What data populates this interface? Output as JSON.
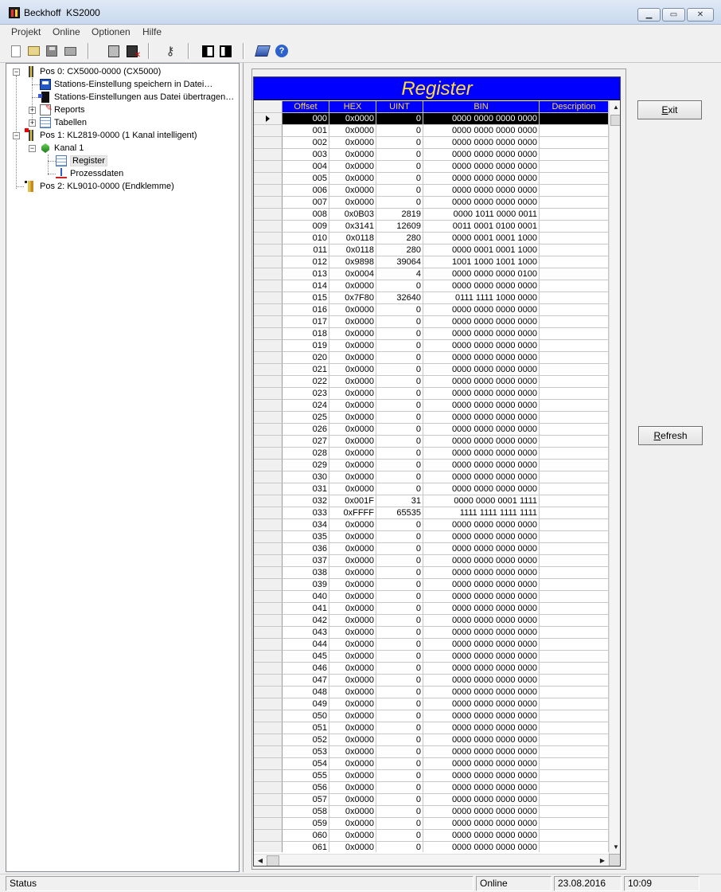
{
  "window": {
    "title": "Beckhoff  KS2000",
    "min": "▁",
    "max": "▭",
    "close": "✕"
  },
  "menu": [
    "Projekt",
    "Online",
    "Optionen",
    "Hilfe"
  ],
  "toolbar": [
    "new-icon",
    "open-icon",
    "save-icon",
    "print-icon",
    "online-icon",
    "offline-icon",
    "key-icon",
    "left-pane-icon",
    "right-pane-icon",
    "book-icon",
    "help-icon"
  ],
  "tree": [
    {
      "label": "Pos 0: CX5000-0000  (CX5000)",
      "icon": "cx5000-icon",
      "expander": "−"
    },
    {
      "label": "Stations-Einstellung speichern in Datei…",
      "icon": "save-settings-icon"
    },
    {
      "label": "Stations-Einstellungen aus Datei übertragen…",
      "icon": "load-settings-icon"
    },
    {
      "label": "Reports",
      "icon": "reports-icon",
      "expander": "+"
    },
    {
      "label": "Tabellen",
      "icon": "tables-icon",
      "expander": "+"
    },
    {
      "label": "Pos 1: KL2819-0000  (1 Kanal intelligent)",
      "icon": "kl2819-icon",
      "expander": "−"
    },
    {
      "label": "Kanal 1",
      "icon": "channel-icon",
      "expander": "−"
    },
    {
      "label": "Register",
      "icon": "register-icon"
    },
    {
      "label": "Prozessdaten",
      "icon": "process-data-icon"
    },
    {
      "label": "Pos 2: KL9010-0000  (Endklemme)",
      "icon": "kl9010-icon"
    }
  ],
  "grid": {
    "caption": "Register",
    "columns": [
      "Offset",
      "HEX",
      "UINT",
      "BIN",
      "Description"
    ],
    "rows": [
      [
        "000",
        "0x0000",
        "0",
        "0000 0000 0000 0000",
        ""
      ],
      [
        "001",
        "0x0000",
        "0",
        "0000 0000 0000 0000",
        ""
      ],
      [
        "002",
        "0x0000",
        "0",
        "0000 0000 0000 0000",
        ""
      ],
      [
        "003",
        "0x0000",
        "0",
        "0000 0000 0000 0000",
        ""
      ],
      [
        "004",
        "0x0000",
        "0",
        "0000 0000 0000 0000",
        ""
      ],
      [
        "005",
        "0x0000",
        "0",
        "0000 0000 0000 0000",
        ""
      ],
      [
        "006",
        "0x0000",
        "0",
        "0000 0000 0000 0000",
        ""
      ],
      [
        "007",
        "0x0000",
        "0",
        "0000 0000 0000 0000",
        ""
      ],
      [
        "008",
        "0x0B03",
        "2819",
        "0000 1011 0000 0011",
        ""
      ],
      [
        "009",
        "0x3141",
        "12609",
        "0011 0001 0100 0001",
        ""
      ],
      [
        "010",
        "0x0118",
        "280",
        "0000 0001 0001 1000",
        ""
      ],
      [
        "011",
        "0x0118",
        "280",
        "0000 0001 0001 1000",
        ""
      ],
      [
        "012",
        "0x9898",
        "39064",
        "1001 1000 1001 1000",
        ""
      ],
      [
        "013",
        "0x0004",
        "4",
        "0000 0000 0000 0100",
        ""
      ],
      [
        "014",
        "0x0000",
        "0",
        "0000 0000 0000 0000",
        ""
      ],
      [
        "015",
        "0x7F80",
        "32640",
        "0111 1111 1000 0000",
        ""
      ],
      [
        "016",
        "0x0000",
        "0",
        "0000 0000 0000 0000",
        ""
      ],
      [
        "017",
        "0x0000",
        "0",
        "0000 0000 0000 0000",
        ""
      ],
      [
        "018",
        "0x0000",
        "0",
        "0000 0000 0000 0000",
        ""
      ],
      [
        "019",
        "0x0000",
        "0",
        "0000 0000 0000 0000",
        ""
      ],
      [
        "020",
        "0x0000",
        "0",
        "0000 0000 0000 0000",
        ""
      ],
      [
        "021",
        "0x0000",
        "0",
        "0000 0000 0000 0000",
        ""
      ],
      [
        "022",
        "0x0000",
        "0",
        "0000 0000 0000 0000",
        ""
      ],
      [
        "023",
        "0x0000",
        "0",
        "0000 0000 0000 0000",
        ""
      ],
      [
        "024",
        "0x0000",
        "0",
        "0000 0000 0000 0000",
        ""
      ],
      [
        "025",
        "0x0000",
        "0",
        "0000 0000 0000 0000",
        ""
      ],
      [
        "026",
        "0x0000",
        "0",
        "0000 0000 0000 0000",
        ""
      ],
      [
        "027",
        "0x0000",
        "0",
        "0000 0000 0000 0000",
        ""
      ],
      [
        "028",
        "0x0000",
        "0",
        "0000 0000 0000 0000",
        ""
      ],
      [
        "029",
        "0x0000",
        "0",
        "0000 0000 0000 0000",
        ""
      ],
      [
        "030",
        "0x0000",
        "0",
        "0000 0000 0000 0000",
        ""
      ],
      [
        "031",
        "0x0000",
        "0",
        "0000 0000 0000 0000",
        ""
      ],
      [
        "032",
        "0x001F",
        "31",
        "0000 0000 0001 1111",
        ""
      ],
      [
        "033",
        "0xFFFF",
        "65535",
        "1111 1111 1111 1111",
        ""
      ],
      [
        "034",
        "0x0000",
        "0",
        "0000 0000 0000 0000",
        ""
      ],
      [
        "035",
        "0x0000",
        "0",
        "0000 0000 0000 0000",
        ""
      ],
      [
        "036",
        "0x0000",
        "0",
        "0000 0000 0000 0000",
        ""
      ],
      [
        "037",
        "0x0000",
        "0",
        "0000 0000 0000 0000",
        ""
      ],
      [
        "038",
        "0x0000",
        "0",
        "0000 0000 0000 0000",
        ""
      ],
      [
        "039",
        "0x0000",
        "0",
        "0000 0000 0000 0000",
        ""
      ],
      [
        "040",
        "0x0000",
        "0",
        "0000 0000 0000 0000",
        ""
      ],
      [
        "041",
        "0x0000",
        "0",
        "0000 0000 0000 0000",
        ""
      ],
      [
        "042",
        "0x0000",
        "0",
        "0000 0000 0000 0000",
        ""
      ],
      [
        "043",
        "0x0000",
        "0",
        "0000 0000 0000 0000",
        ""
      ],
      [
        "044",
        "0x0000",
        "0",
        "0000 0000 0000 0000",
        ""
      ],
      [
        "045",
        "0x0000",
        "0",
        "0000 0000 0000 0000",
        ""
      ],
      [
        "046",
        "0x0000",
        "0",
        "0000 0000 0000 0000",
        ""
      ],
      [
        "047",
        "0x0000",
        "0",
        "0000 0000 0000 0000",
        ""
      ],
      [
        "048",
        "0x0000",
        "0",
        "0000 0000 0000 0000",
        ""
      ],
      [
        "049",
        "0x0000",
        "0",
        "0000 0000 0000 0000",
        ""
      ],
      [
        "050",
        "0x0000",
        "0",
        "0000 0000 0000 0000",
        ""
      ],
      [
        "051",
        "0x0000",
        "0",
        "0000 0000 0000 0000",
        ""
      ],
      [
        "052",
        "0x0000",
        "0",
        "0000 0000 0000 0000",
        ""
      ],
      [
        "053",
        "0x0000",
        "0",
        "0000 0000 0000 0000",
        ""
      ],
      [
        "054",
        "0x0000",
        "0",
        "0000 0000 0000 0000",
        ""
      ],
      [
        "055",
        "0x0000",
        "0",
        "0000 0000 0000 0000",
        ""
      ],
      [
        "056",
        "0x0000",
        "0",
        "0000 0000 0000 0000",
        ""
      ],
      [
        "057",
        "0x0000",
        "0",
        "0000 0000 0000 0000",
        ""
      ],
      [
        "058",
        "0x0000",
        "0",
        "0000 0000 0000 0000",
        ""
      ],
      [
        "059",
        "0x0000",
        "0",
        "0000 0000 0000 0000",
        ""
      ],
      [
        "060",
        "0x0000",
        "0",
        "0000 0000 0000 0000",
        ""
      ],
      [
        "061",
        "0x0000",
        "0",
        "0000 0000 0000 0000",
        ""
      ]
    ],
    "selected_offset": "000",
    "scroll_up": "▲",
    "scroll_down": "▼",
    "scroll_left": "◀",
    "scroll_right": "▶"
  },
  "buttons": {
    "exit": {
      "first": "E",
      "rest": "xit"
    },
    "refresh": {
      "first": "R",
      "rest": "efresh"
    }
  },
  "statusbar": {
    "status": "Status",
    "mode": "Online",
    "date": "23.08.2016",
    "time": "10:09"
  }
}
